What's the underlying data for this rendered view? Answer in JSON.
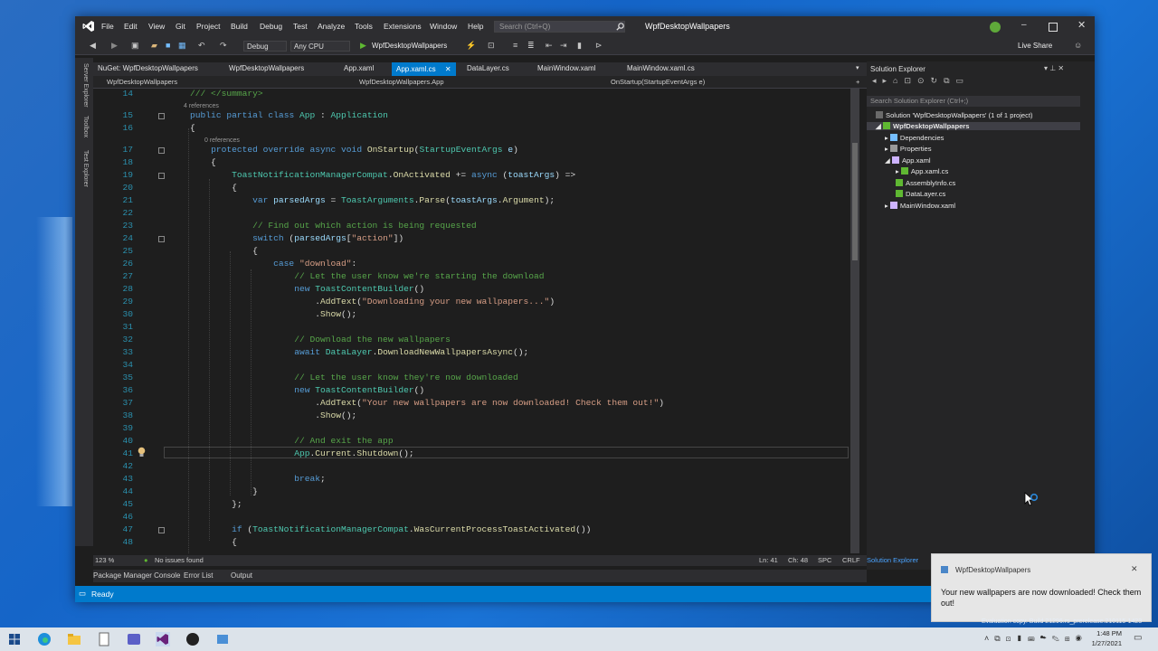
{
  "menu": {
    "items": [
      "File",
      "Edit",
      "View",
      "Git",
      "Project",
      "Build",
      "Debug",
      "Test",
      "Analyze",
      "Tools",
      "Extensions",
      "Window",
      "Help"
    ],
    "search_placeholder": "Search (Ctrl+Q)",
    "window_title": "WpfDesktopWallpapers"
  },
  "toolbar": {
    "config": "Debug",
    "platform": "Any CPU",
    "run_target": "WpfDesktopWallpapers",
    "live_share": "Live Share"
  },
  "side_strip": {
    "server_explorer": "Server Explorer",
    "toolbox": "Toolbox",
    "test_explorer": "Test Explorer"
  },
  "tabs": [
    "NuGet: WpfDesktopWallpapers",
    "WpfDesktopWallpapers",
    "App.xaml",
    "App.xaml.cs",
    "DataLayer.cs",
    "MainWindow.xaml",
    "MainWindow.xaml.cs"
  ],
  "navbar": {
    "project": "WpfDesktopWallpapers",
    "class": "WpfDesktopWallpapers.App",
    "member": "OnStartup(StartupEventArgs e)"
  },
  "code": {
    "line_numbers": [
      "14",
      "15",
      "16",
      "17",
      "18",
      "19",
      "20",
      "21",
      "22",
      "23",
      "24",
      "25",
      "26",
      "27",
      "28",
      "29",
      "30",
      "31",
      "32",
      "33",
      "34",
      "35",
      "36",
      "37",
      "38",
      "39",
      "40",
      "41",
      "42",
      "43",
      "44",
      "45",
      "46",
      "47",
      "48"
    ],
    "lines": [
      "    /// </summary>",
      "    public partial class App : Application",
      "    {",
      "        protected override async void OnStartup(StartupEventArgs e)",
      "        {",
      "            ToastNotificationManagerCompat.OnActivated += async (toastArgs) =>",
      "            {",
      "                var parsedArgs = ToastArguments.Parse(toastArgs.Argument);",
      "",
      "                // Find out which action is being requested",
      "                switch (parsedArgs[\"action\"])",
      "                {",
      "                    case \"download\":",
      "                        // Let the user know we're starting the download",
      "                        new ToastContentBuilder()",
      "                            .AddText(\"Downloading your new wallpapers...\")",
      "                            .Show();",
      "",
      "                        // Download the new wallpapers",
      "                        await DataLayer.DownloadNewWallpapersAsync();",
      "",
      "                        // Let the user know they're now downloaded",
      "                        new ToastContentBuilder()",
      "                            .AddText(\"Your new wallpapers are now downloaded! Check them out!\")",
      "                            .Show();",
      "",
      "                        // And exit the app",
      "                        App.Current.Shutdown();",
      "",
      "                        break;",
      "                }",
      "            };",
      "",
      "            if (ToastNotificationManagerCompat.WasCurrentProcessToastActivated())",
      "            {"
    ],
    "refs_4": "4 references",
    "refs_0": "0 references"
  },
  "editor_status": {
    "zoom": "123 %",
    "issues": "No issues found",
    "line": "Ln: 41",
    "col": "Ch: 48",
    "spc": "SPC",
    "crlf": "CRLF"
  },
  "bottom_tabs": [
    "Package Manager Console",
    "Error List",
    "Output"
  ],
  "status": {
    "ready": "Ready"
  },
  "solution_explorer": {
    "title": "Solution Explorer",
    "search_placeholder": "Search Solution Explorer (Ctrl+;)",
    "solution": "Solution 'WpfDesktopWallpapers' (1 of 1 project)",
    "project": "WpfDesktopWallpapers",
    "items": [
      "Dependencies",
      "Properties",
      "App.xaml",
      "App.xaml.cs",
      "AssemblyInfo.cs",
      "DataLayer.cs",
      "MainWindow.xaml"
    ],
    "footer": "Solution Explorer"
  },
  "toast": {
    "app": "WpfDesktopWallpapers",
    "message": "Your new wallpapers are now downloaded! Check them out!"
  },
  "desktop": {
    "eval": "Evaluation copy. Build 21296.rs_prerelease.210115-1423"
  },
  "clock": {
    "time": "1:48 PM",
    "date": "1/27/2021"
  },
  "colors": {
    "accent": "#007acc",
    "editor_bg": "#1e1e1e"
  }
}
